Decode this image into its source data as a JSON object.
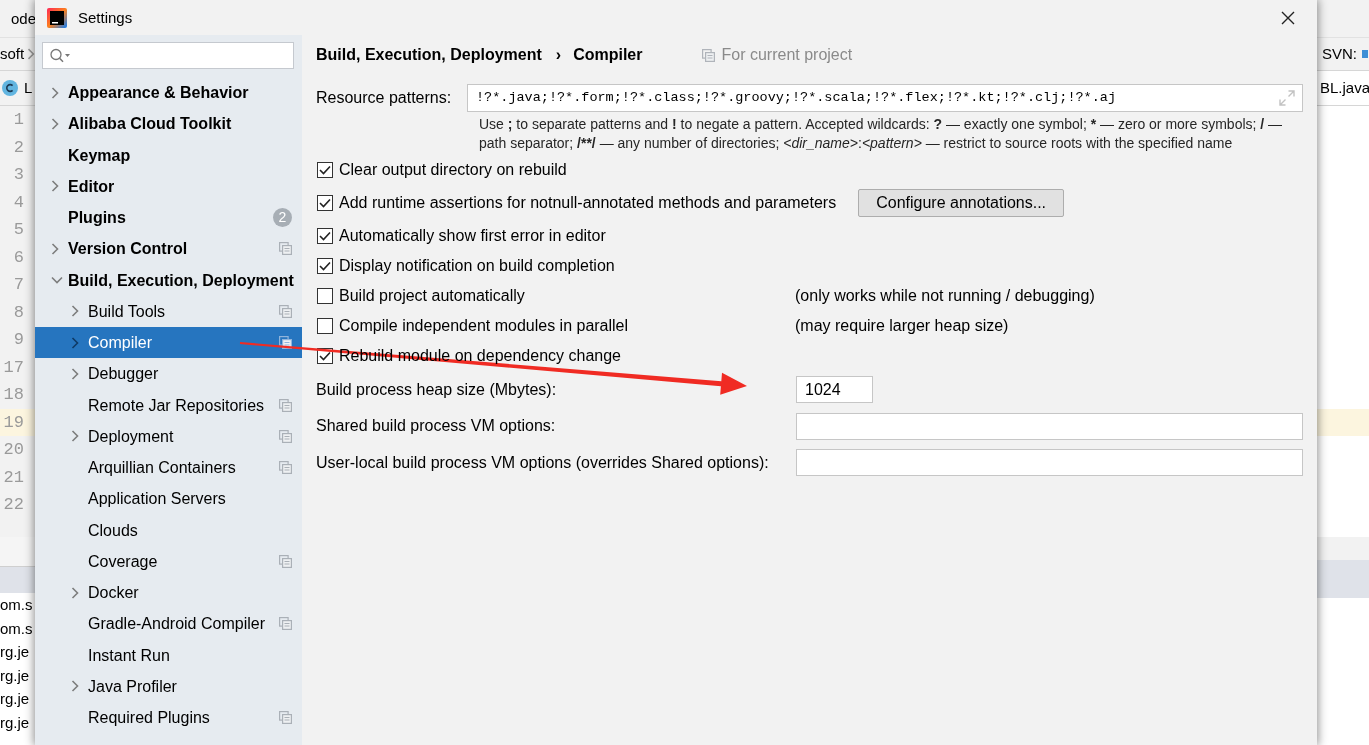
{
  "background_ide": {
    "menu_item": "ode",
    "breadcrumb": "soft",
    "tab_label": "L",
    "line_numbers": [
      {
        "text": "1",
        "current": false
      },
      {
        "text": "2",
        "current": false
      },
      {
        "text": "3",
        "current": false
      },
      {
        "text": "4",
        "current": false
      },
      {
        "text": "5",
        "current": false
      },
      {
        "text": "6",
        "current": false
      },
      {
        "text": "7",
        "current": false
      },
      {
        "text": "8",
        "current": false
      },
      {
        "text": "9",
        "current": false
      },
      {
        "text": "17",
        "current": false
      },
      {
        "text": "18",
        "current": false
      },
      {
        "text": "19",
        "current": true
      },
      {
        "text": "20",
        "current": false
      },
      {
        "text": "21",
        "current": false
      },
      {
        "text": "22",
        "current": false
      }
    ],
    "console_lines": [
      "om.s",
      "om.s",
      "rg.je",
      "rg.je",
      "rg.je",
      "rg.je"
    ],
    "vcs_label": "SVN:",
    "right_tab_label": "BL.java"
  },
  "window": {
    "title": "Settings"
  },
  "sidebar": {
    "items": [
      {
        "label": "Appearance & Behavior",
        "expanded": false,
        "selected": false,
        "project_scoped": false
      },
      {
        "label": "Alibaba Cloud Toolkit",
        "expanded": false,
        "selected": false,
        "project_scoped": false
      },
      {
        "label": "Keymap",
        "selected": false,
        "project_scoped": false
      },
      {
        "label": "Editor",
        "expanded": false,
        "selected": false,
        "project_scoped": false
      },
      {
        "label": "Plugins",
        "selected": false,
        "project_scoped": false,
        "badge": "2"
      },
      {
        "label": "Version Control",
        "expanded": false,
        "selected": false,
        "project_scoped": true
      },
      {
        "label": "Build, Execution, Deployment",
        "expanded": true,
        "selected": false,
        "project_scoped": false,
        "children": [
          {
            "label": "Build Tools",
            "expanded": false,
            "selected": false,
            "project_scoped": true
          },
          {
            "label": "Compiler",
            "expanded": false,
            "selected": true,
            "project_scoped": true
          },
          {
            "label": "Debugger",
            "expanded": false,
            "selected": false,
            "project_scoped": false
          },
          {
            "label": "Remote Jar Repositories",
            "selected": false,
            "project_scoped": true
          },
          {
            "label": "Deployment",
            "expanded": false,
            "selected": false,
            "project_scoped": true
          },
          {
            "label": "Arquillian Containers",
            "selected": false,
            "project_scoped": true
          },
          {
            "label": "Application Servers",
            "selected": false,
            "project_scoped": false
          },
          {
            "label": "Clouds",
            "selected": false,
            "project_scoped": false
          },
          {
            "label": "Coverage",
            "selected": false,
            "project_scoped": true
          },
          {
            "label": "Docker",
            "expanded": false,
            "selected": false,
            "project_scoped": false
          },
          {
            "label": "Gradle-Android Compiler",
            "selected": false,
            "project_scoped": true
          },
          {
            "label": "Instant Run",
            "selected": false,
            "project_scoped": false
          },
          {
            "label": "Java Profiler",
            "expanded": false,
            "selected": false,
            "project_scoped": false
          },
          {
            "label": "Required Plugins",
            "selected": false,
            "project_scoped": true
          }
        ]
      }
    ]
  },
  "breadcrumb": {
    "parts": [
      "Build, Execution, Deployment",
      "Compiler"
    ],
    "separator": "›"
  },
  "scope_note": "For current project",
  "resource_patterns": {
    "label": "Resource patterns:",
    "value": "!?*.java;!?*.form;!?*.class;!?*.groovy;!?*.scala;!?*.flex;!?*.kt;!?*.clj;!?*.aj",
    "help": [
      {
        "text": "Use ",
        "kind": "plain"
      },
      {
        "text": ";",
        "kind": "bold"
      },
      {
        "text": " to separate patterns and ",
        "kind": "plain"
      },
      {
        "text": "!",
        "kind": "bold"
      },
      {
        "text": " to negate a pattern. Accepted wildcards: ",
        "kind": "plain"
      },
      {
        "text": "?",
        "kind": "bold"
      },
      {
        "text": " — exactly one symbol; ",
        "kind": "plain"
      },
      {
        "text": "*",
        "kind": "bold"
      },
      {
        "text": " — zero or more symbols; ",
        "kind": "plain"
      },
      {
        "text": "/",
        "kind": "bold"
      },
      {
        "text": " — path separator; ",
        "kind": "plain"
      },
      {
        "text": "/**/",
        "kind": "bold"
      },
      {
        "text": " — any number of directories; ",
        "kind": "plain"
      },
      {
        "text": "<dir_name>",
        "kind": "italic"
      },
      {
        "text": ":",
        "kind": "plain"
      },
      {
        "text": "<pattern>",
        "kind": "italic"
      },
      {
        "text": " — restrict to source roots with the specified name",
        "kind": "plain"
      }
    ]
  },
  "options": [
    {
      "label": "Clear output directory on rebuild",
      "checked": true
    },
    {
      "label": "Add runtime assertions for notnull-annotated methods and parameters",
      "checked": true,
      "button": "Configure annotations..."
    },
    {
      "label": "Automatically show first error in editor",
      "checked": true
    },
    {
      "label": "Display notification on build completion",
      "checked": true
    },
    {
      "label": "Build project automatically",
      "checked": false,
      "note": "(only works while not running / debugging)"
    },
    {
      "label": "Compile independent modules in parallel",
      "checked": false,
      "note": "(may require larger heap size)"
    },
    {
      "label": "Rebuild module on dependency change",
      "checked": true
    }
  ],
  "fields": [
    {
      "label": "Build process heap size (Mbytes):",
      "value": "1024",
      "kind": "short"
    },
    {
      "label": "Shared build process VM options:",
      "kind": "wide"
    },
    {
      "label": "User-local build process VM options (overrides Shared options):",
      "kind": "wide"
    }
  ]
}
